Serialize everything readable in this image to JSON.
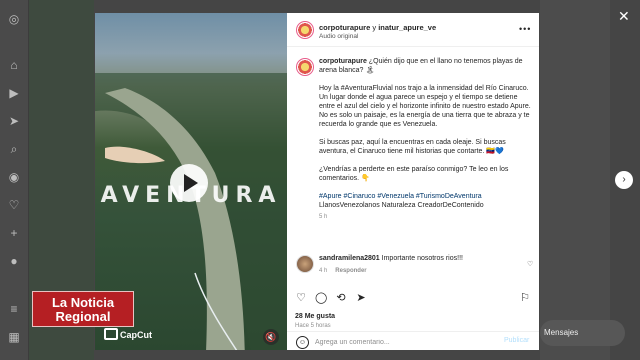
{
  "header": {
    "account_1": "corpoturapure",
    "conjunction": "y",
    "account_2": "inatur_apure_ve",
    "audio": "Audio original"
  },
  "caption": {
    "user": "corpoturapure",
    "line_1": "¿Quién dijo que en el llano no tenemos playas de arena blanca? 🏝",
    "para_1": "Hoy la #AventuraFluvial nos trajo a la inmensidad del Río Cinaruco. Un lugar donde el agua parece un espejo y el tiempo se detiene entre el azul del cielo y el horizonte infinito de nuestro estado Apure. No es solo un paisaje, es la energía de una tierra que te abraza y te recuerda lo grande que es Venezuela.",
    "para_2": "Si buscas paz, aquí la encuentras en cada oleaje. Si buscas aventura, el Cinaruco tiene mil historias que contarte. 🇻🇪💙",
    "para_3": "¿Vendrías a perderte en este paraíso conmigo? Te leo en los comentarios. 👇",
    "hashtags": "#Apure #Cinaruco #Venezuela #TurismoDeAventura",
    "tags_plain": "LlanosVenezolanos Naturaleza CreadorDeContenido",
    "time": "5 h"
  },
  "comment": {
    "user": "sandramilena2801",
    "text": "Importante nosotros rios!!!",
    "time": "4 h",
    "reply": "Responder"
  },
  "post": {
    "likes": "28 Me gusta",
    "date": "Hace 5 horas"
  },
  "comment_box": {
    "placeholder": "Agrega un comentario...",
    "publish": "Publicar"
  },
  "video": {
    "overlay_text": "AVENTURA"
  },
  "overlay": {
    "news_line1": "La Noticia",
    "news_line2": "Regional",
    "capcut": "CapCut"
  },
  "messages_label": "Mensajes",
  "icons": {
    "close": "close-icon",
    "next": "chevron-right-icon",
    "like": "heart-icon",
    "comment": "comment-icon",
    "share": "share-icon",
    "save": "bookmark-icon"
  },
  "colors": {
    "hashtag": "#00376b",
    "news_red": "#b51f23",
    "publish_disabled": "#b2dffc"
  }
}
